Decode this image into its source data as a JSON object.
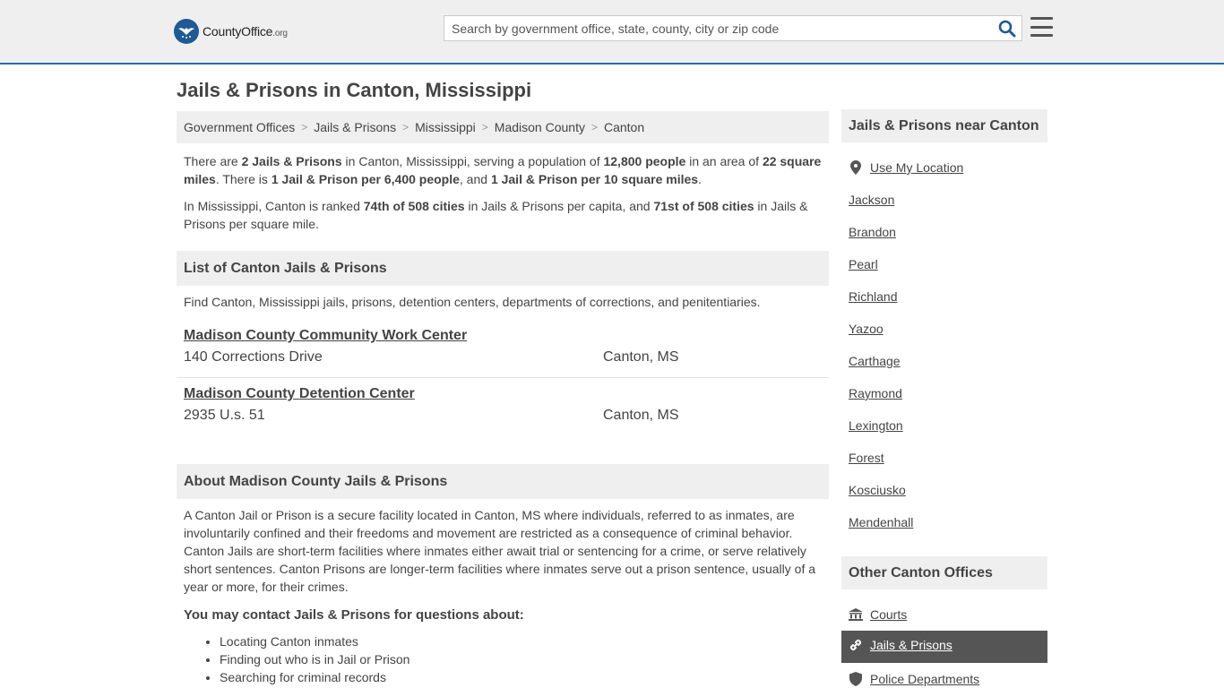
{
  "header": {
    "logo_main": "CountyOffice",
    "logo_suffix": ".org",
    "search_placeholder": "Search by government office, state, county, city or zip code"
  },
  "page": {
    "title": "Jails & Prisons in Canton, Mississippi"
  },
  "breadcrumb": [
    "Government Offices",
    "Jails & Prisons",
    "Mississippi",
    "Madison County",
    "Canton"
  ],
  "intro": {
    "p1_a": "There are ",
    "p1_b": "2 Jails & Prisons",
    "p1_c": " in Canton, Mississippi, serving a population of ",
    "p1_d": "12,800 people",
    "p1_e": " in an area of ",
    "p1_f": "22 square miles",
    "p1_g": ". There is ",
    "p1_h": "1 Jail & Prison per 6,400 people",
    "p1_i": ", and ",
    "p1_j": "1 Jail & Prison per 10 square miles",
    "p1_k": ".",
    "p2_a": "In Mississippi, Canton is ranked ",
    "p2_b": "74th of 508 cities",
    "p2_c": " in Jails & Prisons per capita, and ",
    "p2_d": "71st of 508 cities",
    "p2_e": " in Jails & Prisons per square mile."
  },
  "list_section": {
    "heading": "List of Canton Jails & Prisons",
    "description": "Find Canton, Mississippi jails, prisons, detention centers, departments of corrections, and penitentiaries.",
    "items": [
      {
        "name": "Madison County Community Work Center",
        "address": "140 Corrections Drive",
        "city": "Canton, MS"
      },
      {
        "name": "Madison County Detention Center",
        "address": "2935 U.s. 51",
        "city": "Canton, MS"
      }
    ]
  },
  "about_section": {
    "heading": "About Madison County Jails & Prisons",
    "body": "A Canton Jail or Prison is a secure facility located in Canton, MS where individuals, referred to as inmates, are involuntarily confined and their freedoms and movement are restricted as a consequence of criminal behavior. Canton Jails are short-term facilities where inmates either await trial or sentencing for a crime, or serve relatively short sentences. Canton Prisons are longer-term facilities where inmates serve out a prison sentence, usually of a year or more, for their crimes.",
    "contact_heading": "You may contact Jails & Prisons for questions about:",
    "bullets": [
      "Locating Canton inmates",
      "Finding out who is in Jail or Prison",
      "Searching for criminal records"
    ]
  },
  "sidebar": {
    "nearby_heading": "Jails & Prisons near Canton",
    "use_location": "Use My Location",
    "nearby": [
      "Jackson",
      "Brandon",
      "Pearl",
      "Richland",
      "Yazoo",
      "Carthage",
      "Raymond",
      "Lexington",
      "Forest",
      "Kosciusko",
      "Mendenhall"
    ],
    "other_heading": "Other Canton Offices",
    "other": [
      {
        "label": "Courts",
        "icon": "courthouse-icon"
      },
      {
        "label": "Jails & Prisons",
        "icon": "link-icon"
      },
      {
        "label": "Police Departments",
        "icon": "shield-icon"
      }
    ]
  },
  "colors": {
    "header_bg": "#efefef",
    "header_border": "#2b6ca3",
    "accent": "#1e5a94",
    "active_bg": "#555555",
    "text": "#444444"
  }
}
